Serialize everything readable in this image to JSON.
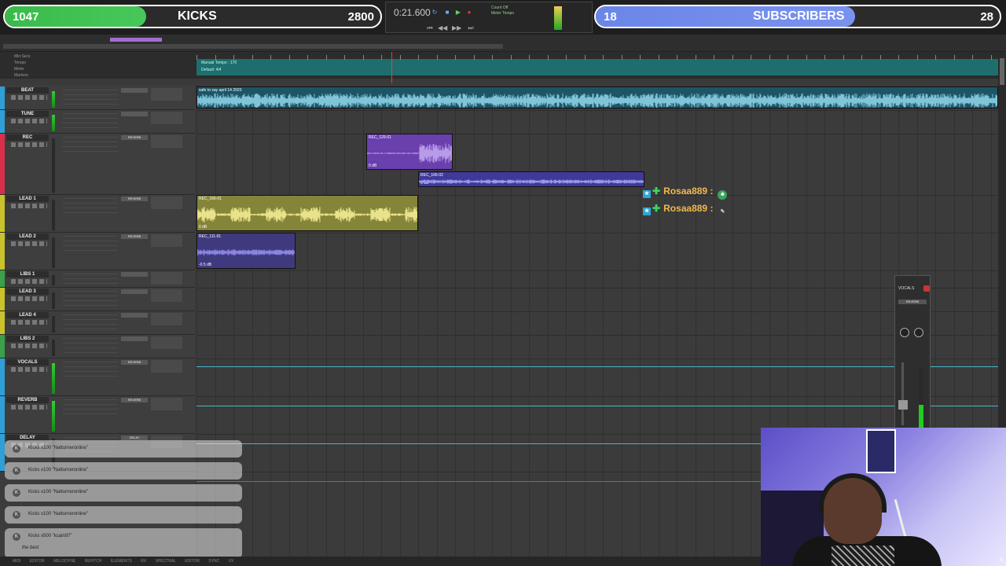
{
  "overlay": {
    "left_count": "1047",
    "left_label": "KICKS",
    "left_goal": "2800",
    "right_count": "18",
    "right_label": "SUBSCRIBERS",
    "right_goal": "28"
  },
  "transport": {
    "counter": "0:21.600",
    "tempo_label": "Count Off",
    "tempo_sub": "Meter Tempo"
  },
  "rulers": {
    "names": [
      "Min:Secs",
      "Tempo",
      "Meter",
      "Markers"
    ],
    "tempo_lane_label": "Manual Tempo : 170",
    "meter_label": "Default: 4/4"
  },
  "tracks": [
    {
      "name": "BEAT",
      "color": "#2f9fd8",
      "send": "",
      "meter": true
    },
    {
      "name": "TUNE",
      "color": "#2f9fd8",
      "send": "",
      "meter": true
    },
    {
      "name": "REC",
      "color": "#d8304a",
      "send": "REVERB",
      "meter": false
    },
    {
      "name": "LEAD 1",
      "color": "#c9c22a",
      "send": "REVERB",
      "meter": false
    },
    {
      "name": "LEAD 2",
      "color": "#c9c22a",
      "send": "REVERB",
      "meter": false
    },
    {
      "name": "LIBS 1",
      "color": "#3aa04a",
      "send": "",
      "meter": false
    },
    {
      "name": "LEAD 3",
      "color": "#c9c22a",
      "send": "",
      "meter": false
    },
    {
      "name": "LEAD 4",
      "color": "#c9c22a",
      "send": "",
      "meter": false
    },
    {
      "name": "LIBS 2",
      "color": "#3aa04a",
      "send": "",
      "meter": false
    },
    {
      "name": "VOCALS",
      "color": "#2f9fd8",
      "send": "REVERB",
      "meter": true
    },
    {
      "name": "REVERB",
      "color": "#2f9fd8",
      "send": "REVERB",
      "meter": true
    },
    {
      "name": "DELAY",
      "color": "#2f9fd8",
      "send": "DELAY",
      "meter": false
    }
  ],
  "clips": {
    "beat": {
      "name": "safe to say april 14 2020",
      "color": "#1f5c6c"
    },
    "rec1": {
      "name": "REC_129-01",
      "gain": "0 dB",
      "color": "#6a3fae"
    },
    "rec2": {
      "name": "REC_166-02",
      "gain": "0 dB",
      "color": "#3f3a9a"
    },
    "lead1": {
      "name": "REC_166-01",
      "gain": "0 dB",
      "color": "#8a8a3a"
    },
    "lead2": {
      "name": "REC_111-01",
      "gain": "-0.5 dB",
      "color": "#3f3a7e"
    }
  },
  "chat": [
    {
      "user": "Rosaa889",
      "sep": ":",
      "emote": "☻"
    },
    {
      "user": "Rosaa889",
      "sep": ":",
      "emote": "✎"
    }
  ],
  "float_mixer": {
    "title": "VOCALS",
    "send": "REVERB"
  },
  "alerts": [
    {
      "text": "Kicks x100 \"Natturneronline\"",
      "sub": ""
    },
    {
      "text": "Kicks x100 \"Natturneronline\"",
      "sub": ""
    },
    {
      "text": "Kicks x100 \"Natturneronline\"",
      "sub": ""
    },
    {
      "text": "Kicks x100 \"Natturneronline\"",
      "sub": ""
    },
    {
      "text": "Kicks x500 \"kcain97\"",
      "sub": "the best"
    }
  ],
  "bottom_tabs": "MIDI EDITOR  MELODYNE  REPITCH ELEMENTS  RX SPECTRAL EDITOR  SYNC VX",
  "webcam_corner": "6"
}
